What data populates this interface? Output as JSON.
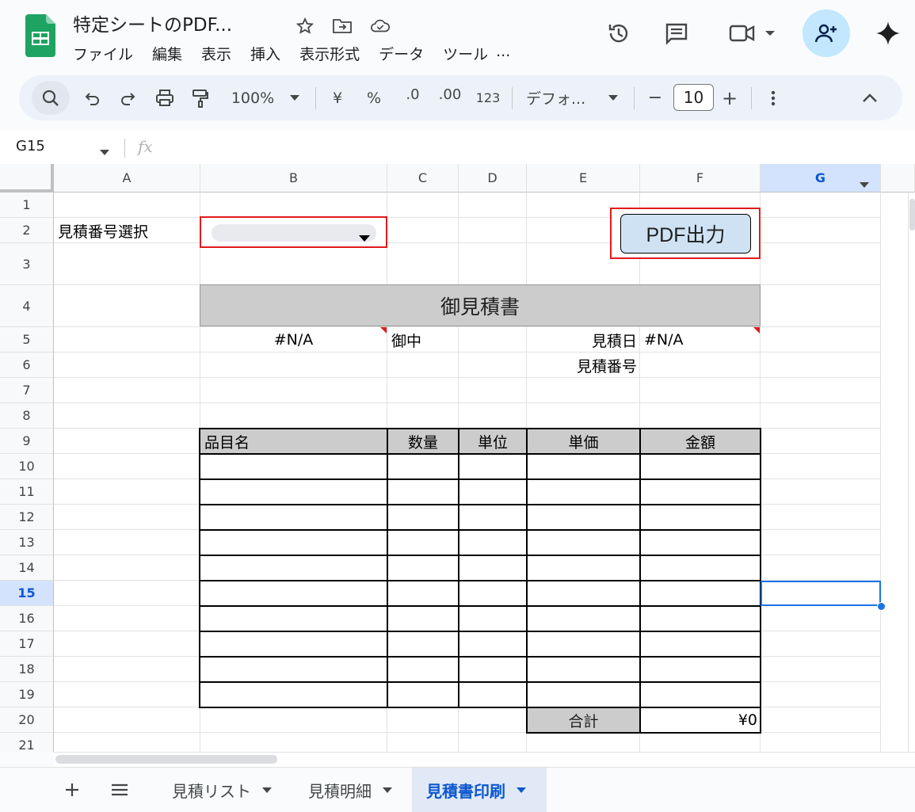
{
  "doc": {
    "title": "特定シートのPDF...",
    "menus": [
      "ファイル",
      "編集",
      "表示",
      "挿入",
      "表示形式",
      "データ",
      "ツール",
      "..."
    ]
  },
  "toolbar": {
    "zoom": "100%",
    "currency": "¥",
    "percent": "%",
    "dec_dec": ".0",
    "dec_inc": ".00",
    "number_format": "123",
    "font": "デフォ...",
    "font_size": "10",
    "minus": "−",
    "plus": "+"
  },
  "formula": {
    "cell_ref": "G15",
    "fx": "fx",
    "value": ""
  },
  "columns": [
    "A",
    "B",
    "C",
    "D",
    "E",
    "F",
    "G"
  ],
  "rows": [
    "1",
    "2",
    "3",
    "4",
    "5",
    "6",
    "7",
    "8",
    "9",
    "10",
    "11",
    "12",
    "13",
    "14",
    "15",
    "16",
    "17",
    "18",
    "19",
    "20",
    "21"
  ],
  "sheet": {
    "select_label": "見積番号選択",
    "pdf_button": "PDF出力",
    "heading": "御見積書",
    "customer": "#N/A",
    "onchu": "御中",
    "date_label": "見積日",
    "date_value": "#N/A",
    "number_label": "見積番号",
    "headers": [
      "品目名",
      "数量",
      "単位",
      "単価",
      "金額"
    ],
    "total_label": "合計",
    "total_value": "¥0"
  },
  "tabs": [
    "見積リスト",
    "見積明細",
    "見積書印刷"
  ],
  "active_tab": "見積書印刷",
  "colors": {
    "accent": "#0b57d0",
    "selection": "#1a73e8",
    "header_gray": "#cccccc",
    "red_outline": "#e01b1b"
  }
}
